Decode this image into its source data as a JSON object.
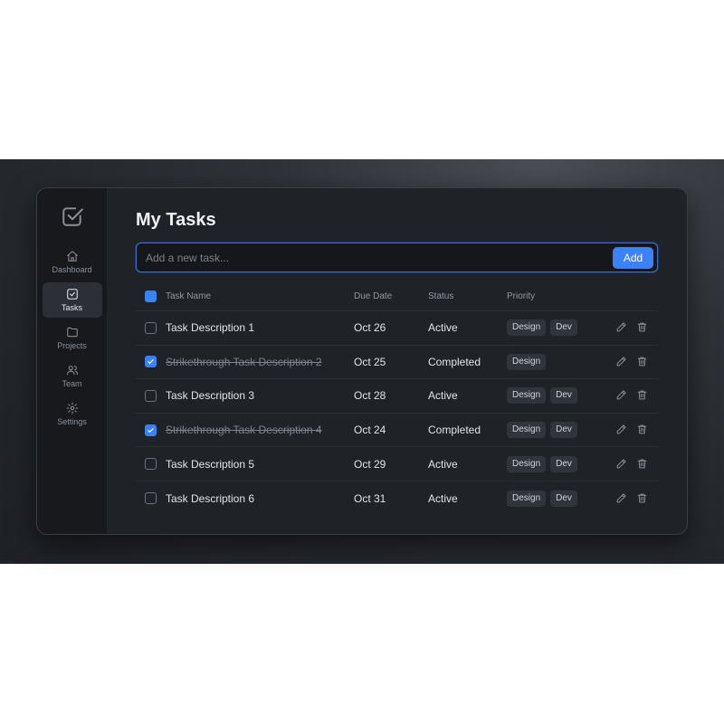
{
  "page": {
    "title": "My Tasks"
  },
  "sidebar": {
    "logo_icon": "check-square-icon",
    "items": [
      {
        "label": "Dashboard",
        "icon": "home-icon",
        "active": false
      },
      {
        "label": "Tasks",
        "icon": "check-square-icon",
        "active": true
      },
      {
        "label": "Projects",
        "icon": "folder-icon",
        "active": false
      },
      {
        "label": "Team",
        "icon": "users-icon",
        "active": false
      },
      {
        "label": "Settings",
        "icon": "gear-icon",
        "active": false
      }
    ]
  },
  "add_task": {
    "placeholder": "Add a new task...",
    "value": "",
    "button_label": "Add"
  },
  "table": {
    "columns": {
      "name": "Task Name",
      "due": "Due Date",
      "status": "Status",
      "priority": "Priority"
    },
    "rows": [
      {
        "checked": false,
        "name": "Task Description 1",
        "due": "Oct 26",
        "status": "Active",
        "tags": [
          "Design",
          "Dev"
        ]
      },
      {
        "checked": true,
        "name": "Strikethrough Task Description 2",
        "due": "Oct 25",
        "status": "Completed",
        "tags": [
          "Design"
        ]
      },
      {
        "checked": false,
        "name": "Task Description 3",
        "due": "Oct 28",
        "status": "Active",
        "tags": [
          "Design",
          "Dev"
        ]
      },
      {
        "checked": true,
        "name": "Strikethrough Task Description 4",
        "due": "Oct 24",
        "status": "Completed",
        "tags": [
          "Design",
          "Dev"
        ]
      },
      {
        "checked": false,
        "name": "Task Description 5",
        "due": "Oct 29",
        "status": "Active",
        "tags": [
          "Design",
          "Dev"
        ]
      },
      {
        "checked": false,
        "name": "Task Description 6",
        "due": "Oct 31",
        "status": "Active",
        "tags": [
          "Design",
          "Dev"
        ]
      }
    ],
    "row_actions": [
      "pencil-icon",
      "trash-icon"
    ]
  },
  "colors": {
    "accent": "#3b82f6",
    "background": "#1f2227",
    "sidebar": "#17191d",
    "tag": "#30343b"
  }
}
